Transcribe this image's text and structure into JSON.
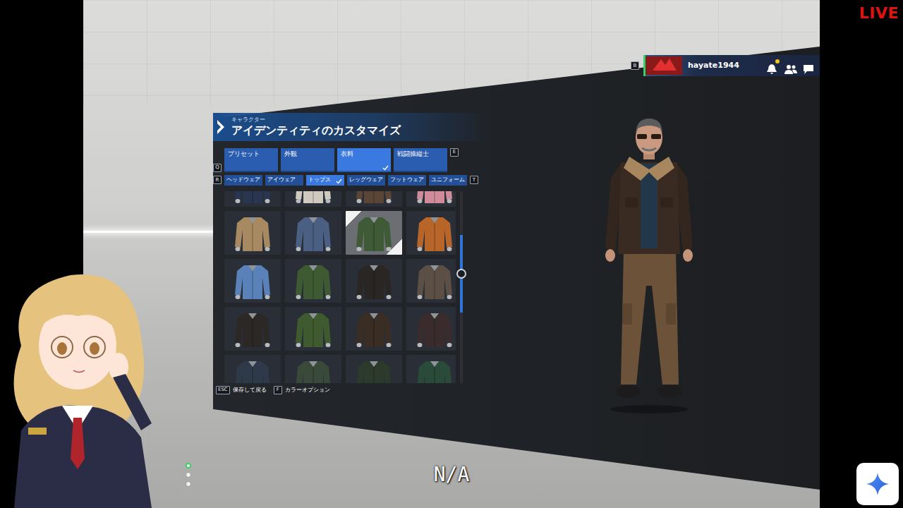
{
  "stream": {
    "live": "LIVE",
    "caption": "N/A"
  },
  "menu": {
    "subtitle": "キャラクター",
    "title": "アイデンティティのカスタマイズ"
  },
  "tab_keys": {
    "prev": "Q",
    "next": "E"
  },
  "tabs": [
    {
      "label": "プリセット",
      "selected": false
    },
    {
      "label": "外観",
      "selected": false
    },
    {
      "label": "衣料",
      "selected": true
    },
    {
      "label": "戦闘操縦士",
      "selected": false
    }
  ],
  "subtab_keys": {
    "prev": "R",
    "next": "T"
  },
  "subtabs": [
    {
      "label": "ヘッドウェア",
      "selected": false
    },
    {
      "label": "アイウェア",
      "selected": false
    },
    {
      "label": "トップス",
      "selected": true
    },
    {
      "label": "レッグウェア",
      "selected": false
    },
    {
      "label": "フットウェア",
      "selected": false
    },
    {
      "label": "ユニフォーム",
      "selected": false
    }
  ],
  "items": [
    {
      "color": "#2a3550",
      "selected": false
    },
    {
      "color": "#cfc9bf",
      "selected": false
    },
    {
      "color": "#5a4536",
      "selected": false
    },
    {
      "color": "#d08a9a",
      "selected": false
    },
    {
      "color": "#a88a62",
      "selected": false
    },
    {
      "color": "#4a5f82",
      "selected": false
    },
    {
      "color": "#3f5a36",
      "selected": true
    },
    {
      "color": "#b8652a",
      "selected": false
    },
    {
      "color": "#5b82b8",
      "selected": false
    },
    {
      "color": "#3d5a33",
      "selected": false
    },
    {
      "color": "#2a2624",
      "selected": false
    },
    {
      "color": "#5c5046",
      "selected": false
    },
    {
      "color": "#2b2826",
      "selected": false
    },
    {
      "color": "#3f5a2f",
      "selected": false
    },
    {
      "color": "#3a2d24",
      "selected": false
    },
    {
      "color": "#3a2c2c",
      "selected": false
    },
    {
      "color": "#2e3a4a",
      "selected": false
    },
    {
      "color": "#3a4a3a",
      "selected": false
    },
    {
      "color": "#2c3a2c",
      "selected": false
    },
    {
      "color": "#2a4a3a",
      "selected": false
    }
  ],
  "scroll": {
    "level": 0.38
  },
  "footer": [
    {
      "key": "ESC",
      "label": "保存して戻る"
    },
    {
      "key": "F",
      "label": "カラーオプション"
    }
  ],
  "profile": {
    "key": "B",
    "username": "hayate1944",
    "notification": true
  },
  "page_dots": [
    {
      "selected": true
    },
    {
      "selected": false
    },
    {
      "selected": false
    }
  ]
}
